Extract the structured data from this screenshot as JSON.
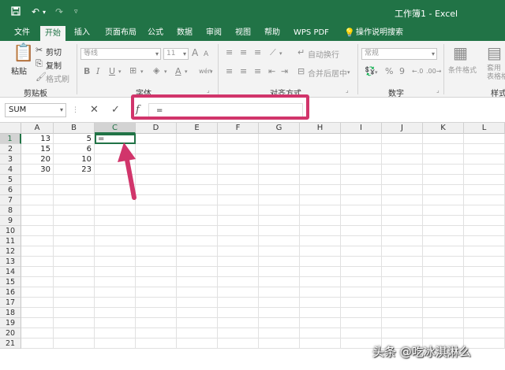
{
  "window": {
    "title": "工作簿1  -  Excel"
  },
  "quick_access": {
    "save_icon": "save-icon",
    "undo_icon": "undo-icon",
    "redo_icon": "redo-icon",
    "customize_icon": "customize-icon"
  },
  "tabs": [
    {
      "label": "文件",
      "active": false
    },
    {
      "label": "开始",
      "active": true
    },
    {
      "label": "插入",
      "active": false
    },
    {
      "label": "页面布局",
      "active": false
    },
    {
      "label": "公式",
      "active": false
    },
    {
      "label": "数据",
      "active": false
    },
    {
      "label": "审阅",
      "active": false
    },
    {
      "label": "视图",
      "active": false
    },
    {
      "label": "帮助",
      "active": false
    },
    {
      "label": "WPS PDF",
      "active": false
    },
    {
      "label": "操作说明搜索",
      "active": false
    }
  ],
  "ribbon": {
    "clipboard": {
      "paste": "粘贴",
      "cut": "剪切",
      "copy": "复制",
      "format_painter": "格式刷",
      "label": "剪贴板"
    },
    "font": {
      "font_name": "等线",
      "font_size": "11",
      "bold": "B",
      "italic": "I",
      "underline": "U",
      "grow": "A",
      "shrink": "A",
      "color_a": "A",
      "label": "字体"
    },
    "alignment": {
      "wrap_text": "自动换行",
      "merge_center": "合并后居中",
      "label": "对齐方式"
    },
    "number": {
      "format": "常规",
      "percent": "%",
      "comma": "9",
      "label": "数字"
    },
    "styles": {
      "conditional": "条件格式",
      "table_format": "套用\n表格格式",
      "label": "样式"
    }
  },
  "formula_bar": {
    "name_box": "SUM",
    "cancel": "✕",
    "enter": "✓",
    "fx": "f",
    "value": "="
  },
  "grid": {
    "columns": [
      "A",
      "B",
      "C",
      "D",
      "E",
      "F",
      "G",
      "H",
      "I",
      "J",
      "K",
      "L"
    ],
    "selected_column": "C",
    "rows": [
      "1",
      "2",
      "3",
      "4",
      "5",
      "6",
      "7",
      "8",
      "9",
      "10",
      "11",
      "12",
      "13",
      "14",
      "15",
      "16",
      "17",
      "18",
      "19",
      "20",
      "21"
    ],
    "selected_row": "1",
    "cells": [
      {
        "row": 1,
        "col": "A",
        "value": "13"
      },
      {
        "row": 1,
        "col": "B",
        "value": "5"
      },
      {
        "row": 2,
        "col": "A",
        "value": "15"
      },
      {
        "row": 2,
        "col": "B",
        "value": "6"
      },
      {
        "row": 3,
        "col": "A",
        "value": "20"
      },
      {
        "row": 3,
        "col": "B",
        "value": "10"
      },
      {
        "row": 4,
        "col": "A",
        "value": "30"
      },
      {
        "row": 4,
        "col": "B",
        "value": "23"
      }
    ],
    "active_cell": {
      "row": 1,
      "col": "C",
      "value": "="
    }
  },
  "annotation": {
    "highlight_color": "#d1356b"
  },
  "watermark": "头条 @吃冰淇淋么",
  "colors": {
    "brand": "#217346",
    "annotation": "#d1356b"
  }
}
